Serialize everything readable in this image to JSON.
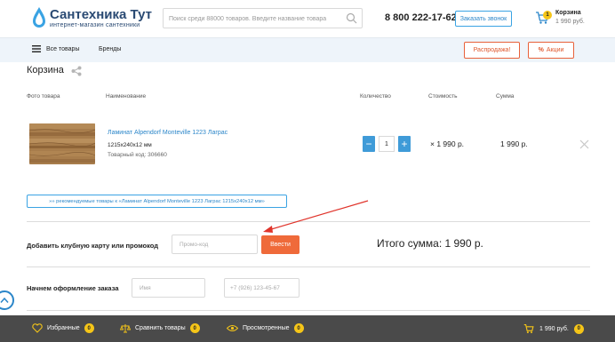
{
  "colors": {
    "brand_blue": "#2b86c9",
    "accent_orange": "#ef6a3a",
    "badge_yellow": "#f5c518",
    "footer_bg": "#4a4a4a",
    "nav_bg": "#eef4fa",
    "annotation_arrow": "#e0342b"
  },
  "header": {
    "logo_title": "Сантехника Тут",
    "logo_subtitle": "интернет-магазин сантехники",
    "search_placeholder": "Поиск среди 88000 товаров. Введите название товара",
    "phone": "8 800 222-17-62",
    "callback_label": "Заказать звонок",
    "cart_label": "Корзина",
    "cart_count": "1",
    "cart_sum": "1 990 руб."
  },
  "nav": {
    "all_products": "Все товары",
    "brands": "Бренды",
    "sale": "Распродажа!",
    "promo": "Акции"
  },
  "cart": {
    "title": "Корзина",
    "columns": {
      "photo": "Фото товара",
      "name": "Наименование",
      "quantity": "Количество",
      "price": "Стоимость",
      "sum": "Сумма"
    },
    "item": {
      "name": "Ламинат Alpendorf Monteville 1223 Лаграс",
      "size": "1215x240x12 мм",
      "code": "Товарный код: 306660",
      "quantity": "1",
      "price": "× 1 990 р.",
      "sum": "1 990 р."
    },
    "recommend_label": "»» рекомендуемые товары к «Ламинат Alpendorf Monteville 1223 Лаграс 1215x240x12 мм»"
  },
  "promo": {
    "label": "Добавить клубную карту или промокод",
    "placeholder": "Промо-код",
    "submit": "Ввести",
    "total": "Итого сумма: 1 990 р."
  },
  "order": {
    "label": "Начнем оформление заказа",
    "name_placeholder": "Имя",
    "phone_placeholder": "+7 (926) 123-45-67"
  },
  "footer": {
    "favorites": "Избранные",
    "favorites_count": "0",
    "compare": "Сравнить товары",
    "compare_count": "0",
    "viewed": "Просмотренные",
    "viewed_count": "0",
    "cart_sum": "1 990 руб.",
    "cart_count": "0"
  }
}
